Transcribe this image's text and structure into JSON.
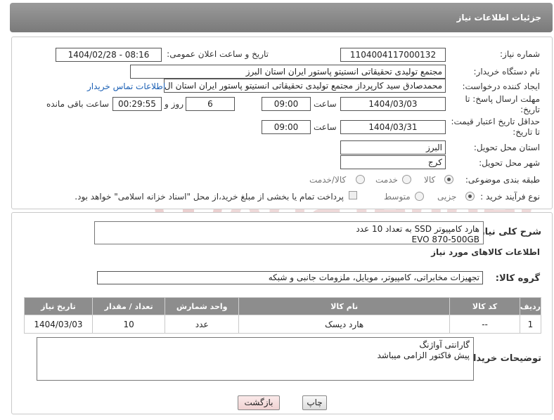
{
  "header": {
    "title": "جزئیات اطلاعات نیاز"
  },
  "form": {
    "need_number_label": "شماره نیاز:",
    "need_number": "1104004117000132",
    "announce_label": "تاریخ و ساعت اعلان عمومی:",
    "announce_value": "1404/02/28 - 08:16",
    "buyer_org_label": "نام دستگاه خریدار:",
    "buyer_org": "مجتمع تولیدی تحقیقاتی انستیتو پاستور ایران استان البرز",
    "requester_label": "ایجاد کننده درخواست:",
    "requester": "محمدصادق سید کارپرداز مجتمع تولیدی تحقیقاتی انستیتو پاستور ایران استان ال",
    "contact_link": "اطلاعات تماس خریدار",
    "deadline_label": "مهلت ارسال پاسخ: تا تاریخ:",
    "deadline_date": "1404/03/03",
    "time_label": "ساعت",
    "deadline_time": "09:00",
    "days_value": "6",
    "days_label": "روز و",
    "remaining_value": "00:29:55",
    "remaining_label": "ساعت باقی مانده",
    "min_price_label": "حداقل تاریخ اعتبار قیمت: تا تاریخ:",
    "min_price_date": "1404/03/31",
    "min_price_time_label": "ساعت",
    "min_price_time": "09:00",
    "province_label": "استان محل تحویل:",
    "province": "البرز",
    "city_label": "شهر محل تحویل:",
    "city": "کرج",
    "category_label": "طبقه بندی موضوعی:",
    "category_options": [
      "کالا",
      "خدمت",
      "کالا/خدمت"
    ],
    "process_label": "نوع فرآیند خرید :",
    "process_options": [
      "جزیی",
      "متوسط"
    ],
    "payment_note": "پرداخت تمام یا بخشی از مبلغ خرید،از محل \"اسناد خزانه اسلامی\" خواهد بود."
  },
  "description": {
    "label": "شرح کلی نیاز:",
    "line1": "هارد کامپیوتر SSD به تعداد 10 عدد",
    "line2": "EVO 870-500GB"
  },
  "goods_section": {
    "title": "اطلاعات کالاهای مورد نیاز",
    "group_label": "گروه کالا:",
    "group_value": "تجهیزات مخابراتی، کامپیوتر، موبایل، ملزومات جانبی و شبکه"
  },
  "table": {
    "headers": [
      "ردیف",
      "کد کالا",
      "نام کالا",
      "واحد شمارش",
      "تعداد / مقدار",
      "تاریخ نیاز"
    ],
    "rows": [
      {
        "row": "1",
        "code": "--",
        "name": "هارد دیسک",
        "unit": "عدد",
        "qty": "10",
        "date": "1404/03/03"
      }
    ]
  },
  "buyer_notes": {
    "label": "توضیحات خریدار:",
    "line1": "گارانتی آواژنگ",
    "line2": "پیش فاکتور الزامی میباشد"
  },
  "buttons": {
    "print": "چاپ",
    "back": "بازگشت"
  },
  "watermark": {
    "text": "AriaTender.neT"
  },
  "colors": {
    "header_bg": "#8a8a8a",
    "link": "#1a5fb4",
    "back_button_bg": "#f6dede",
    "watermark": "#e9c9c9"
  }
}
